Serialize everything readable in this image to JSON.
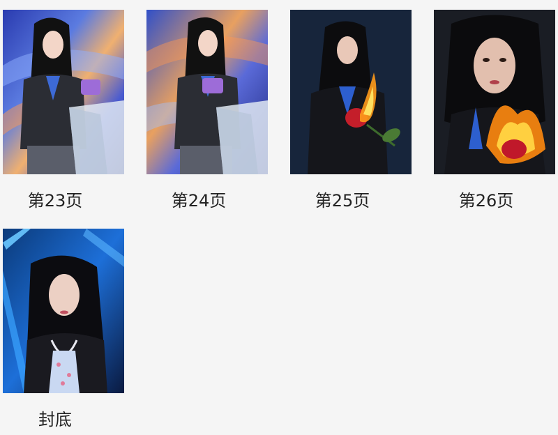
{
  "pages": [
    {
      "label": "第23页",
      "image": "woman in blazer holding purple object at crystal podium"
    },
    {
      "label": "第24页",
      "image": "woman in blazer looking down at purple object at podium"
    },
    {
      "label": "第25页",
      "image": "woman in dark jacket with burning rose"
    },
    {
      "label": "第26页",
      "image": "close-up woman holding flaming rose"
    },
    {
      "label": "封底",
      "image": "woman in leather jacket with pearl necklace, blue neon background"
    }
  ],
  "colors": {
    "background": "#f5f5f5",
    "caption_text": "#222222"
  }
}
